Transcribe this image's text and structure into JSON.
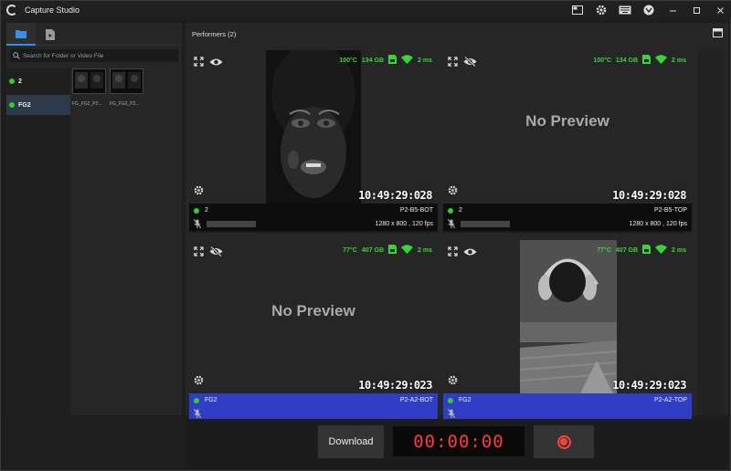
{
  "app": {
    "title": "Capture Studio"
  },
  "titlebar": {
    "icons": [
      "layout-icon",
      "settings-icon",
      "keyboard-icon",
      "feedback-icon"
    ],
    "window_controls": [
      "minimize-icon",
      "maximize-icon",
      "close-icon"
    ]
  },
  "left_panel": {
    "tabs": [
      {
        "icon": "folder-icon",
        "active": true
      },
      {
        "icon": "video-file-icon",
        "active": false
      }
    ],
    "search": {
      "placeholder": "Search for Folder or Video File",
      "value": ""
    },
    "performers": [
      {
        "name": "2",
        "status_color": "#33cc33",
        "selected": false
      },
      {
        "name": "FG2",
        "status_color": "#33cc33",
        "selected": true
      }
    ],
    "thumbnails": [
      {
        "label": "FG_FG2_P2..."
      },
      {
        "label": "FG_FG2_P2..."
      }
    ]
  },
  "right_panel": {
    "title": "Performers (2)",
    "cameras": [
      {
        "temp": "100°C",
        "storage": "134 GB",
        "latency": "2 ms",
        "timecode": "10:49:29:028",
        "performer": "2",
        "camera_id": "P2-B5-BOT",
        "resolution": "1280 x 800 , 120 fps",
        "preview": true,
        "no_preview_text": "",
        "visibility_icon": "eye-icon"
      },
      {
        "temp": "100°C",
        "storage": "134 GB",
        "latency": "2 ms",
        "timecode": "10:49:29:028",
        "performer": "2",
        "camera_id": "P2-B5-TOP",
        "resolution": "1280 x 800 , 120 fps",
        "preview": false,
        "no_preview_text": "No Preview",
        "visibility_icon": "eye-off-icon"
      },
      {
        "temp": "77°C",
        "storage": "407 GB",
        "latency": "2 ms",
        "timecode": "10:49:29:023",
        "performer": "FG2",
        "camera_id": "P2-A2-BOT",
        "resolution": "",
        "preview": false,
        "no_preview_text": "No Preview",
        "visibility_icon": "eye-off-icon"
      },
      {
        "temp": "77°C",
        "storage": "407 GB",
        "latency": "2 ms",
        "timecode": "10:49:29:023",
        "performer": "FG2",
        "camera_id": "P2-A2-TOP",
        "resolution": "",
        "preview": true,
        "no_preview_text": "",
        "visibility_icon": "eye-icon"
      }
    ]
  },
  "bottom_bar": {
    "download_label": "Download",
    "timer": "00:00:00",
    "record_icon": "record-icon"
  },
  "colors": {
    "accent": "#3a8ee6",
    "status_green": "#3ad33a",
    "timer_red": "#ff3b3b",
    "selected_blue": "#2f3ec4"
  }
}
